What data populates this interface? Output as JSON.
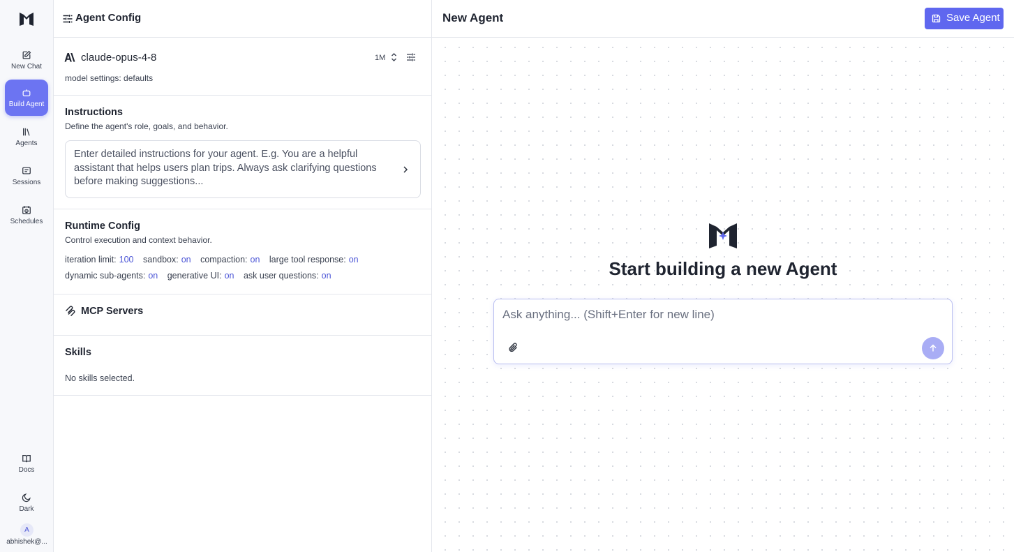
{
  "nav": {
    "items": [
      {
        "label": "New Chat",
        "icon": "edit-icon"
      },
      {
        "label": "Build Agent",
        "icon": "bot-icon",
        "active": true
      },
      {
        "label": "Agents",
        "icon": "library-icon"
      },
      {
        "label": "Sessions",
        "icon": "message-square-icon"
      },
      {
        "label": "Schedules",
        "icon": "calendar-clock-icon"
      }
    ],
    "bottom": [
      {
        "label": "Docs",
        "icon": "book-open-icon"
      },
      {
        "label": "Dark",
        "icon": "moon-icon"
      }
    ],
    "user": {
      "initial": "A",
      "name": "abhishek@..."
    }
  },
  "config": {
    "header_title": "Agent Config",
    "model": {
      "name": "claude-opus-4-8",
      "context": "1M",
      "settings": "model settings: defaults"
    },
    "instructions": {
      "title": "Instructions",
      "subtitle": "Define the agent's role, goals, and behavior.",
      "placeholder": "Enter detailed instructions for your agent. E.g. You are a helpful assistant that helps users plan trips. Always ask clarifying questions before making suggestions..."
    },
    "runtime": {
      "title": "Runtime Config",
      "subtitle": "Control execution and context behavior.",
      "settings": [
        {
          "label": "iteration limit:",
          "value": "100"
        },
        {
          "label": "sandbox:",
          "value": "on"
        },
        {
          "label": "compaction:",
          "value": "on"
        },
        {
          "label": "large tool response:",
          "value": "on"
        },
        {
          "label": "dynamic sub-agents:",
          "value": "on"
        },
        {
          "label": "generative UI:",
          "value": "on"
        },
        {
          "label": "ask user questions:",
          "value": "on"
        }
      ]
    },
    "mcp": {
      "title": "MCP Servers"
    },
    "skills": {
      "title": "Skills",
      "empty": "No skills selected."
    }
  },
  "main": {
    "title": "New Agent",
    "save_label": "Save Agent",
    "hero_title": "Start building a new Agent",
    "composer_placeholder": "Ask anything... (Shift+Enter for new line)"
  },
  "colors": {
    "accent": "#5f67ef",
    "nav_active": "#6c74f2",
    "value_text": "#4b55d6",
    "send_button": "#a9adf5"
  }
}
